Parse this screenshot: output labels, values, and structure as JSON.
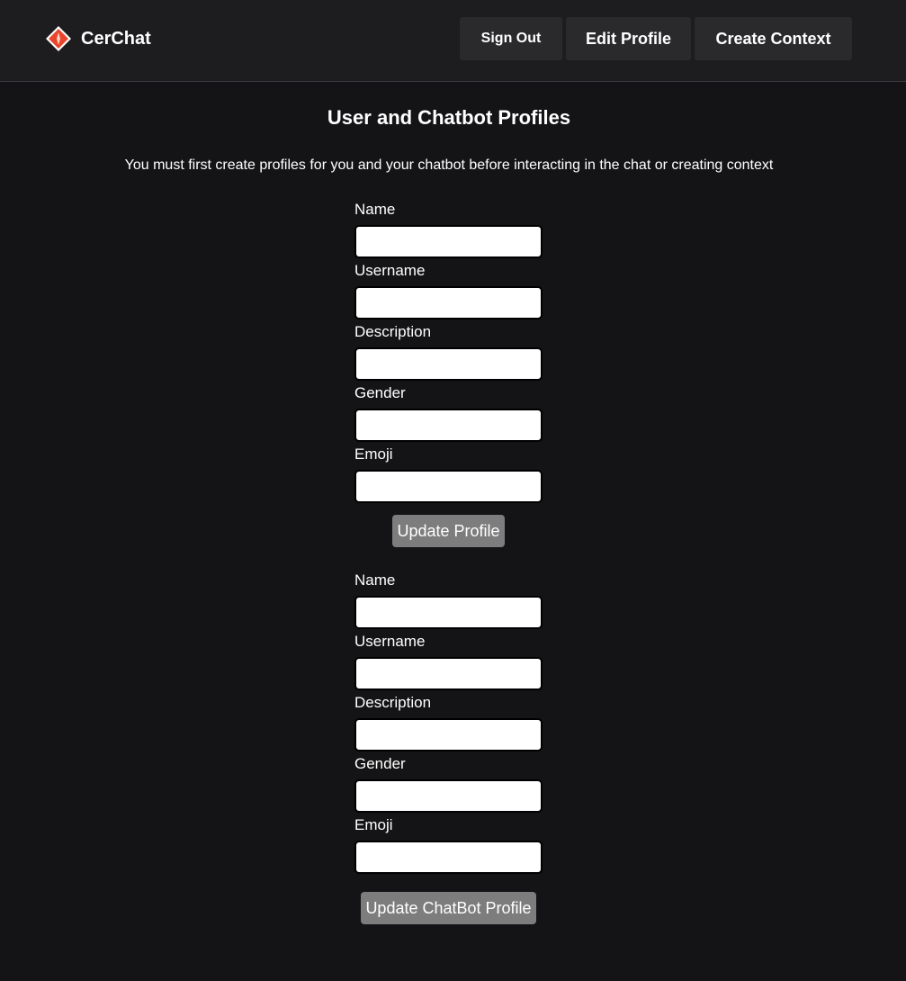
{
  "brand": {
    "name": "CerChat",
    "logo_icon": "cerchat-diamond-logo",
    "accent_color": "#e8452c"
  },
  "nav": {
    "sign_out": "Sign Out",
    "edit_profile": "Edit Profile",
    "create_context": "Create Context"
  },
  "page": {
    "title": "User and Chatbot Profiles",
    "subtitle": "You must first create profiles for you and your chatbot before interacting in the chat or creating context"
  },
  "user_form": {
    "fields": [
      {
        "label": "Name",
        "value": ""
      },
      {
        "label": "Username",
        "value": ""
      },
      {
        "label": "Description",
        "value": ""
      },
      {
        "label": "Gender",
        "value": ""
      },
      {
        "label": "Emoji",
        "value": ""
      }
    ],
    "submit_label": "Update Profile"
  },
  "chatbot_form": {
    "fields": [
      {
        "label": "Name",
        "value": ""
      },
      {
        "label": "Username",
        "value": ""
      },
      {
        "label": "Description",
        "value": ""
      },
      {
        "label": "Gender",
        "value": ""
      },
      {
        "label": "Emoji",
        "value": ""
      }
    ],
    "submit_label": "Update ChatBot Profile"
  }
}
